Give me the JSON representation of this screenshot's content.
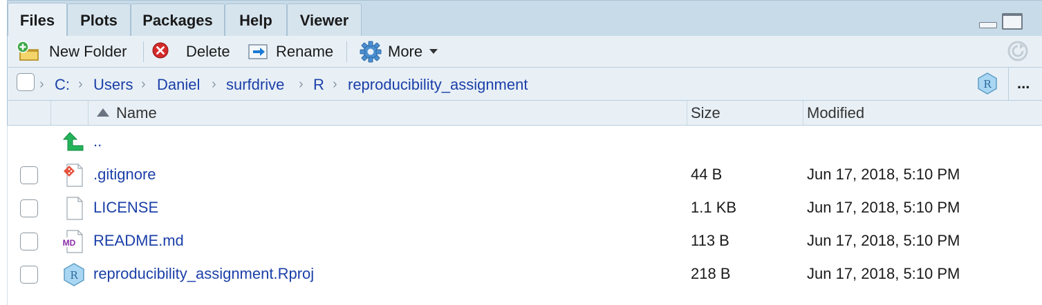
{
  "tabs": [
    {
      "label": "Files",
      "active": true
    },
    {
      "label": "Plots",
      "active": false
    },
    {
      "label": "Packages",
      "active": false
    },
    {
      "label": "Help",
      "active": false
    },
    {
      "label": "Viewer",
      "active": false
    }
  ],
  "toolbar": {
    "new_folder": "New Folder",
    "delete": "Delete",
    "rename": "Rename",
    "more": "More"
  },
  "breadcrumb": {
    "items": [
      "C:",
      "Users",
      "Daniel",
      "surfdrive",
      "R",
      "reproducibility_assignment"
    ],
    "more": "..."
  },
  "columns": {
    "name": "Name",
    "size": "Size",
    "modified": "Modified"
  },
  "parent": {
    "name": ".."
  },
  "files": [
    {
      "name": ".gitignore",
      "size": "44 B",
      "modified": "Jun 17, 2018, 5:10 PM",
      "icon": "git-file-icon"
    },
    {
      "name": "LICENSE",
      "size": "1.1 KB",
      "modified": "Jun 17, 2018, 5:10 PM",
      "icon": "blank-file-icon"
    },
    {
      "name": "README.md",
      "size": "113 B",
      "modified": "Jun 17, 2018, 5:10 PM",
      "icon": "markdown-file-icon"
    },
    {
      "name": "reproducibility_assignment.Rproj",
      "size": "218 B",
      "modified": "Jun 17, 2018, 5:10 PM",
      "icon": "rproj-file-icon"
    }
  ],
  "colors": {
    "link": "#1b3fa8",
    "pane_bg": "#e8f0f6",
    "tab_bar": "#c8dbe8"
  }
}
